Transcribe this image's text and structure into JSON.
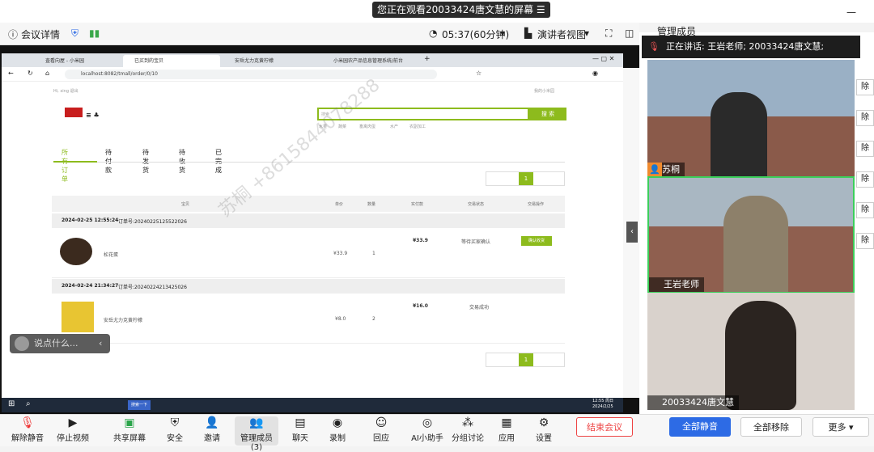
{
  "banner": {
    "viewing": "您正在观看20033424唐文慧的屏幕"
  },
  "meeting_toolbar": {
    "details": "会议详情",
    "timer": "05:37(60分钟)",
    "view": "演讲者视图"
  },
  "browser": {
    "tabs": [
      "査看向屋 - 小米园",
      "已买到的宝贝",
      "安岳尤力克黄柠檬",
      "小米园农产品信息管理系统/前台"
    ],
    "url": "localhost:8082/tmall/order/0/10"
  },
  "shop": {
    "greeting": "Hi,  xing    退出",
    "account_link": "我的小米园",
    "search_placeholder": "搜索",
    "search_button": "搜 索",
    "hot_words": [
      "水果",
      "蔬菜",
      "畜禽肉蛋",
      "水产",
      "农副加工"
    ],
    "order_tabs": [
      "所有订单",
      "待付款",
      "待发货",
      "待收货",
      "已完成"
    ],
    "table_headers": [
      "宝贝",
      "单价",
      "数量",
      "实付款",
      "交易状态",
      "交易操作"
    ],
    "page_number": "1",
    "orders": [
      {
        "date": "2024-02-25 12:55:24",
        "order_no": "订单号:20240225125522026",
        "product": "松花蛋",
        "price": "¥33.9",
        "qty": "1",
        "paid": "¥33.9",
        "status": "等待买家确认",
        "action": "确认收货"
      },
      {
        "date": "2024-02-24 21:34:27",
        "order_no": "订单号:20240224213425026",
        "product": "安岳尤力克黄柠檬",
        "price": "¥8.0",
        "qty": "2",
        "paid": "¥16.0",
        "status": "交易成功",
        "action": ""
      }
    ]
  },
  "watermark": "苏桐 +8615844078288",
  "chat": {
    "placeholder": "说点什么..."
  },
  "taskbar": {
    "time": "12:55 周日",
    "date": "2024/2/25",
    "search": "搜索一下"
  },
  "panel": {
    "title": "管理成员",
    "speaking": "正在讲话:  王岩老师; 20033424唐文慧;",
    "videos": [
      {
        "name": "苏桐"
      },
      {
        "name": "王岩老师"
      },
      {
        "name": "20033424唐文慧"
      }
    ],
    "side_buttons": [
      "除",
      "除",
      "除",
      "除",
      "除",
      "除"
    ],
    "mute_all": "全部静音",
    "remove_all": "全部移除",
    "more": "更多"
  },
  "controls": [
    "解除静音",
    "停止视频",
    "共享屏幕",
    "安全",
    "邀请",
    "管理成员(3)",
    "聊天",
    "录制",
    "回应",
    "AI小助手",
    "分组讨论",
    "应用",
    "设置"
  ],
  "end_meeting": "结束会议"
}
